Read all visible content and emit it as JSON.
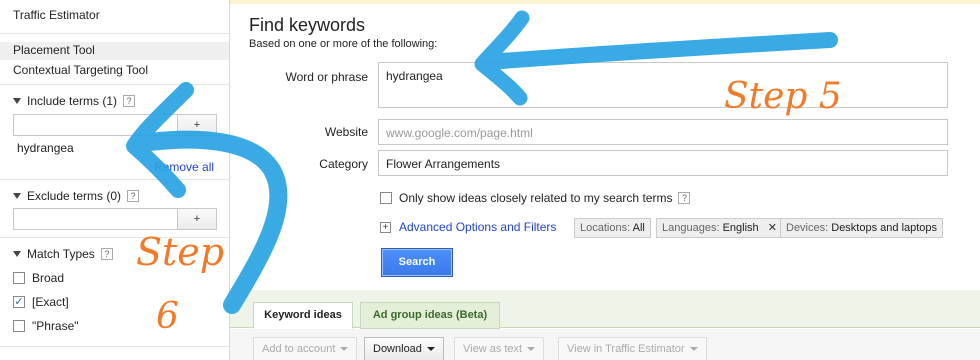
{
  "sidebar": {
    "links": [
      "Traffic Estimator",
      "Placement Tool",
      "Contextual Targeting Tool"
    ],
    "include_terms": {
      "title": "Include terms (1)",
      "add_label": "+",
      "term": "hydrangea",
      "remove_all": "Remove all"
    },
    "exclude_terms": {
      "title": "Exclude terms (0)",
      "add_label": "+"
    },
    "match_types": {
      "title": "Match Types",
      "options": [
        {
          "label": "Broad",
          "checked": false
        },
        {
          "label": "[Exact]",
          "checked": true
        },
        {
          "label": "\"Phrase\"",
          "checked": false
        }
      ]
    },
    "help_glyph": "?"
  },
  "main": {
    "title": "Find keywords",
    "subtitle": "Based on one or more of the following:",
    "word_label": "Word or phrase",
    "word_value": "hydrangea",
    "website_label": "Website",
    "website_placeholder": "www.google.com/page.html",
    "category_label": "Category",
    "category_value": "Flower Arrangements",
    "only_show_label": "Only show ideas closely related to my search terms",
    "advanced_label": "Advanced Options and Filters",
    "chips": [
      {
        "key": "Locations:",
        "value": "All"
      },
      {
        "key": "Languages:",
        "value": "English",
        "removable": true
      },
      {
        "key": "Devices:",
        "value": "Desktops and laptops"
      }
    ],
    "search_label": "Search",
    "tabs": [
      "Keyword ideas",
      "Ad group ideas (Beta)"
    ],
    "toolbar": [
      {
        "label": "Add to account",
        "enabled": false
      },
      {
        "label": "Download",
        "enabled": true
      },
      {
        "label": "View as text",
        "enabled": false
      },
      {
        "label": "View in Traffic Estimator",
        "enabled": false
      }
    ]
  },
  "annotations": {
    "step5": "Step 5",
    "step6_word": "Step",
    "step6_num": "6"
  },
  "colors": {
    "arrow": "#29a3e3",
    "step": "#f07a2a",
    "link": "#2244cc",
    "search_button": "#4d90fe"
  }
}
